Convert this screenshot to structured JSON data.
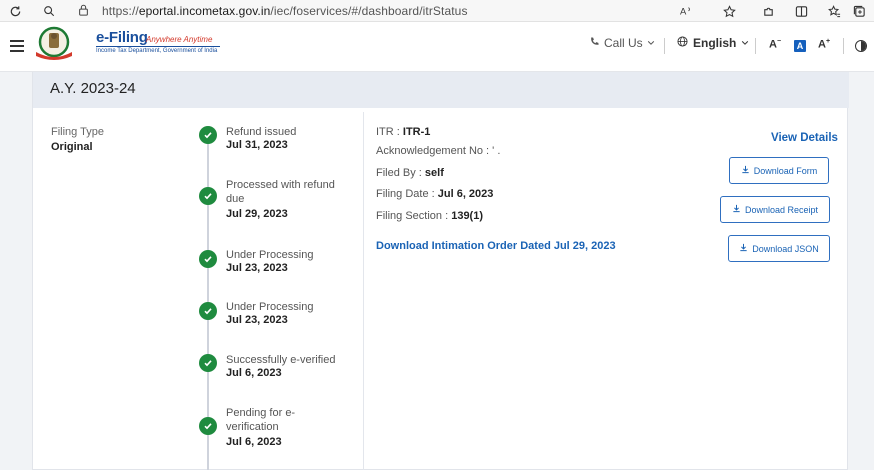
{
  "browser": {
    "url_prefix": "https://",
    "url_host": "eportal.incometax.gov.in",
    "url_path": "/iec/foservices/#/dashboard/itrStatus"
  },
  "header": {
    "logo_title": "e-Filing",
    "logo_tagline": "Anywhere Anytime",
    "logo_subtitle": "Income Tax Department, Government of India",
    "call_us": "Call Us",
    "language": "English",
    "font_decrease": "A",
    "font_normal": "A",
    "font_increase": "A"
  },
  "card": {
    "assessment_year": "A.Y. 2023-24",
    "filing_type_label": "Filing Type",
    "filing_type_value": "Original",
    "timeline": [
      {
        "status": "Refund issued",
        "date": "Jul 31, 2023"
      },
      {
        "status": "Processed with refund due",
        "date": "Jul 29, 2023"
      },
      {
        "status": "Under Processing",
        "date": "Jul 23, 2023"
      },
      {
        "status": "Under Processing",
        "date": "Jul 23, 2023"
      },
      {
        "status": "Successfully e-verified",
        "date": "Jul 6, 2023"
      },
      {
        "status": "Pending for e-verification",
        "date": "Jul 6, 2023"
      }
    ],
    "details": {
      "itr_label": "ITR : ",
      "itr_value": "ITR-1",
      "ack_label": "Acknowledgement No : ",
      "ack_value": "' .",
      "filed_by_label": "Filed By : ",
      "filed_by_value": "self",
      "filing_date_label": "Filing Date : ",
      "filing_date_value": "Jul 6, 2023",
      "filing_section_label": "Filing Section : ",
      "filing_section_value": "139(1)",
      "intimation_link": "Download Intimation Order Dated Jul 29, 2023"
    },
    "actions": {
      "view_details": "View Details",
      "download_form": "Download Form",
      "download_receipt": "Download Receipt",
      "download_json": "Download JSON"
    }
  },
  "colors": {
    "primary_blue": "#1a63b5",
    "success_green": "#1f8b3f",
    "card_header_bg": "#e7ebf2"
  }
}
